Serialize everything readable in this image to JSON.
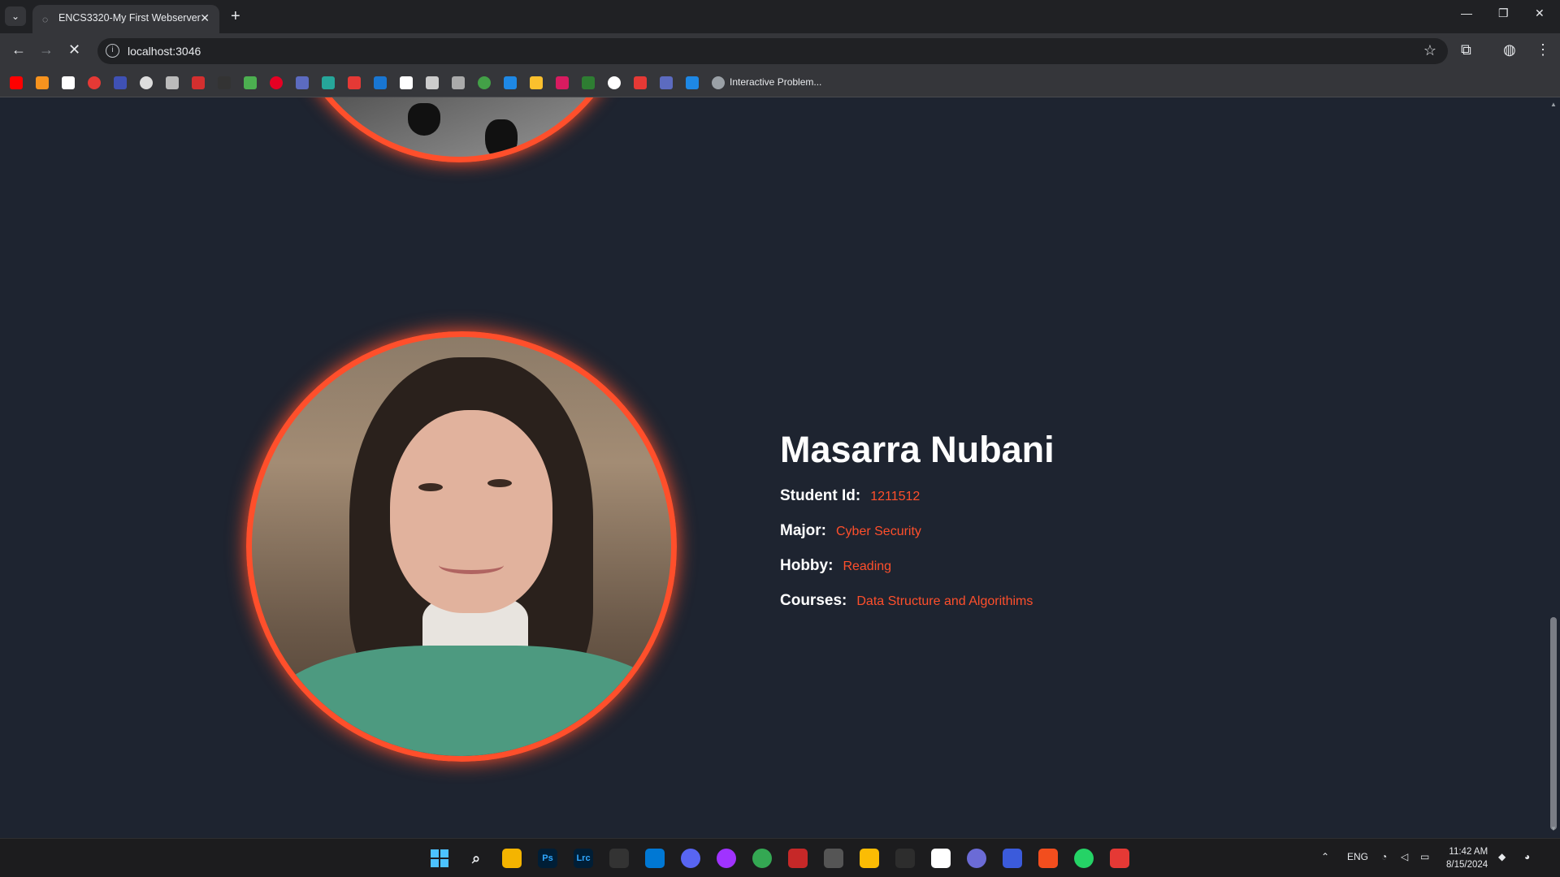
{
  "browser": {
    "tab_title": "ENCS3320-My First Webserver",
    "url": "localhost:3046",
    "bookmark_label": "Interactive Problem..."
  },
  "profile": {
    "name": "Masarra Nubani",
    "fields": [
      {
        "label": "Student Id:",
        "value": "1211512"
      },
      {
        "label": "Major:",
        "value": "Cyber Security"
      },
      {
        "label": "Hobby:",
        "value": "Reading"
      },
      {
        "label": "Courses:",
        "value": "Data Structure and Algorithims"
      }
    ]
  },
  "taskbar": {
    "language": "ENG",
    "time": "11:42 AM",
    "date": "8/15/2024"
  },
  "colors": {
    "accent": "#ff4f2b",
    "page_background": "#1e2430"
  }
}
